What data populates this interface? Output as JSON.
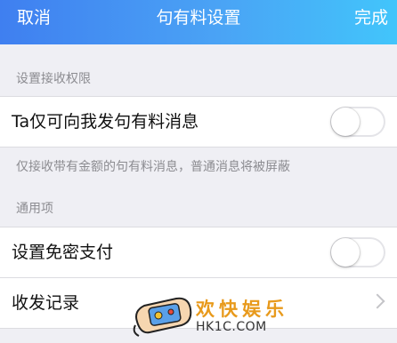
{
  "header": {
    "cancel_label": "取消",
    "title": "句有料设置",
    "done_label": "完成"
  },
  "sections": {
    "receive_permission": {
      "label": "设置接收权限",
      "row_label": "Ta仅可向我发句有料消息",
      "toggle_on": false,
      "description": "仅接收带有金额的句有料消息，普通消息将被屏蔽"
    },
    "general": {
      "label": "通用项",
      "password_free_label": "设置免密支付",
      "password_free_on": false,
      "records_label": "收发记录"
    }
  },
  "watermark": {
    "text": "欢快娱乐",
    "url": "HK1C.COM"
  },
  "colors": {
    "header_gradient_start": "#3f7ff0",
    "header_gradient_end": "#42c5fb",
    "background": "#efeff4"
  }
}
